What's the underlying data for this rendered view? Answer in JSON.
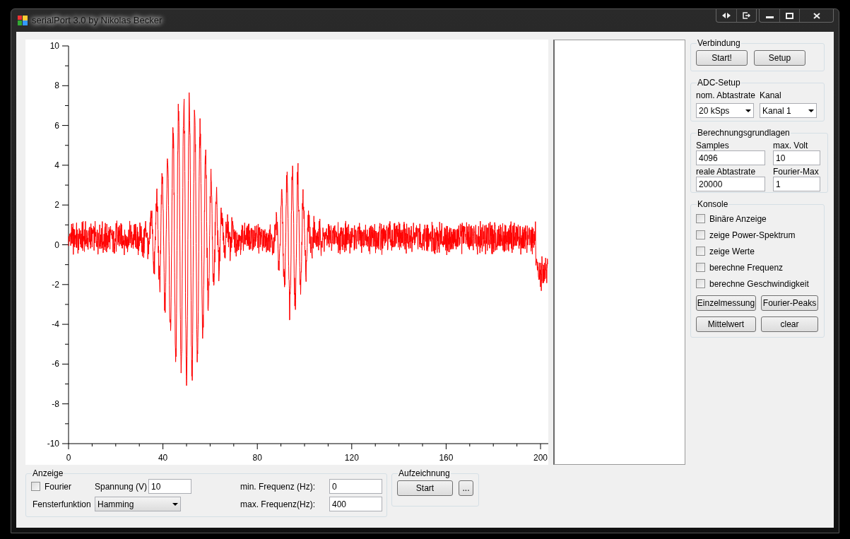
{
  "window": {
    "title": "serialPort 3.0 by Nikolas Becker"
  },
  "plot": {
    "yticks": [
      "10",
      "8",
      "6",
      "4",
      "2",
      "0",
      "-2",
      "-4",
      "-6",
      "-8",
      "-10"
    ],
    "xticks": [
      "0",
      "40",
      "80",
      "120",
      "160",
      "200"
    ]
  },
  "verbindung": {
    "title": "Verbindung",
    "buttons": [
      "Start!",
      "Setup"
    ]
  },
  "adc_setup": {
    "title": "ADC-Setup",
    "fields": [
      {
        "label": "nom. Abtastrate",
        "value": "20 kSps"
      },
      {
        "label": "Kanal",
        "value": "Kanal 1"
      }
    ]
  },
  "berechnungsgrundlagen": {
    "title": "Berechnungsgrundlagen",
    "fields": [
      {
        "label": "Samples",
        "value": "4096"
      },
      {
        "label": "max. Volt",
        "value": "10"
      },
      {
        "label": "reale Abtastrate",
        "value": "20000"
      },
      {
        "label": "Fourier-Max",
        "value": "1"
      }
    ]
  },
  "konsole": {
    "title": "Konsole",
    "options": [
      {
        "label": "Binäre Anzeige",
        "checked": false
      },
      {
        "label": "zeige Power-Spektrum",
        "checked": false
      },
      {
        "label": "zeige Werte",
        "checked": false
      },
      {
        "label": "berechne Frequenz",
        "checked": false
      },
      {
        "label": "berechne Geschwindigkeit",
        "checked": false
      }
    ],
    "buttons": [
      "Einzelmessung",
      "Fourier-Peaks",
      "Mittelwert",
      "clear"
    ]
  },
  "anzeige": {
    "title": "Anzeige",
    "fourier": {
      "label": "Fourier",
      "checked": false
    },
    "spannung": {
      "label": "Spannung (V)",
      "value": "10"
    },
    "fensterfunktion": {
      "label": "Fensterfunktion",
      "value": "Hamming"
    },
    "min_freq": {
      "label": "min. Frequenz (Hz):",
      "value": "0"
    },
    "max_freq": {
      "label": "max. Frequenz(Hz):",
      "value": "400"
    }
  },
  "aufzeichnung": {
    "title": "Aufzeichnung",
    "buttons": [
      "Start",
      "..."
    ]
  }
}
